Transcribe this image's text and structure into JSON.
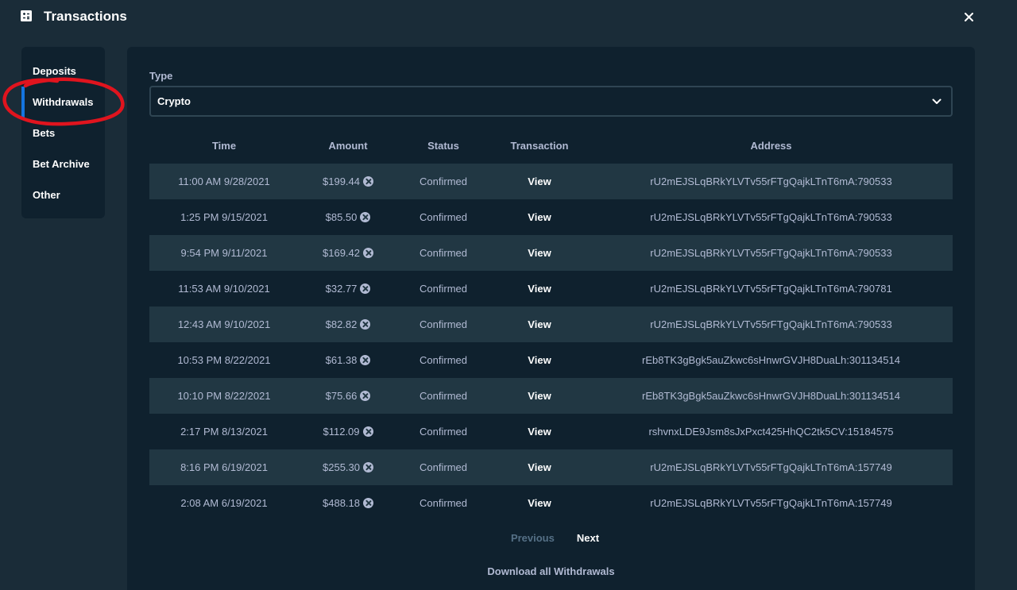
{
  "header": {
    "title": "Transactions",
    "icon": "transactions-icon",
    "close_icon": "close-icon"
  },
  "sidebar": {
    "items": [
      {
        "label": "Deposits",
        "active": false
      },
      {
        "label": "Withdrawals",
        "active": true
      },
      {
        "label": "Bets",
        "active": false
      },
      {
        "label": "Bet Archive",
        "active": false
      },
      {
        "label": "Other",
        "active": false
      }
    ]
  },
  "filter": {
    "label": "Type",
    "value": "Crypto"
  },
  "table": {
    "columns": [
      "Time",
      "Amount",
      "Status",
      "Transaction",
      "Address"
    ],
    "rows": [
      {
        "time": "11:00 AM 9/28/2021",
        "amount": "$199.44",
        "status": "Confirmed",
        "transaction": "View",
        "address": "rU2mEJSLqBRkYLVTv55rFTgQajkLTnT6mA:790533"
      },
      {
        "time": "1:25 PM 9/15/2021",
        "amount": "$85.50",
        "status": "Confirmed",
        "transaction": "View",
        "address": "rU2mEJSLqBRkYLVTv55rFTgQajkLTnT6mA:790533"
      },
      {
        "time": "9:54 PM 9/11/2021",
        "amount": "$169.42",
        "status": "Confirmed",
        "transaction": "View",
        "address": "rU2mEJSLqBRkYLVTv55rFTgQajkLTnT6mA:790533"
      },
      {
        "time": "11:53 AM 9/10/2021",
        "amount": "$32.77",
        "status": "Confirmed",
        "transaction": "View",
        "address": "rU2mEJSLqBRkYLVTv55rFTgQajkLTnT6mA:790781"
      },
      {
        "time": "12:43 AM 9/10/2021",
        "amount": "$82.82",
        "status": "Confirmed",
        "transaction": "View",
        "address": "rU2mEJSLqBRkYLVTv55rFTgQajkLTnT6mA:790533"
      },
      {
        "time": "10:53 PM 8/22/2021",
        "amount": "$61.38",
        "status": "Confirmed",
        "transaction": "View",
        "address": "rEb8TK3gBgk5auZkwc6sHnwrGVJH8DuaLh:301134514"
      },
      {
        "time": "10:10 PM 8/22/2021",
        "amount": "$75.66",
        "status": "Confirmed",
        "transaction": "View",
        "address": "rEb8TK3gBgk5auZkwc6sHnwrGVJH8DuaLh:301134514"
      },
      {
        "time": "2:17 PM 8/13/2021",
        "amount": "$112.09",
        "status": "Confirmed",
        "transaction": "View",
        "address": "rshvnxLDE9Jsm8sJxPxct425HhQC2tk5CV:15184575"
      },
      {
        "time": "8:16 PM 6/19/2021",
        "amount": "$255.30",
        "status": "Confirmed",
        "transaction": "View",
        "address": "rU2mEJSLqBRkYLVTv55rFTgQajkLTnT6mA:157749"
      },
      {
        "time": "2:08 AM 6/19/2021",
        "amount": "$488.18",
        "status": "Confirmed",
        "transaction": "View",
        "address": "rU2mEJSLqBRkYLVTv55rFTgQajkLTnT6mA:157749"
      }
    ]
  },
  "pager": {
    "previous": "Previous",
    "next": "Next"
  },
  "download_label": "Download all Withdrawals",
  "colors": {
    "background": "#1a2c38",
    "panel": "#0f212e",
    "row_alt": "#213743",
    "accent": "#1475e1",
    "annotation": "#e0141e"
  }
}
